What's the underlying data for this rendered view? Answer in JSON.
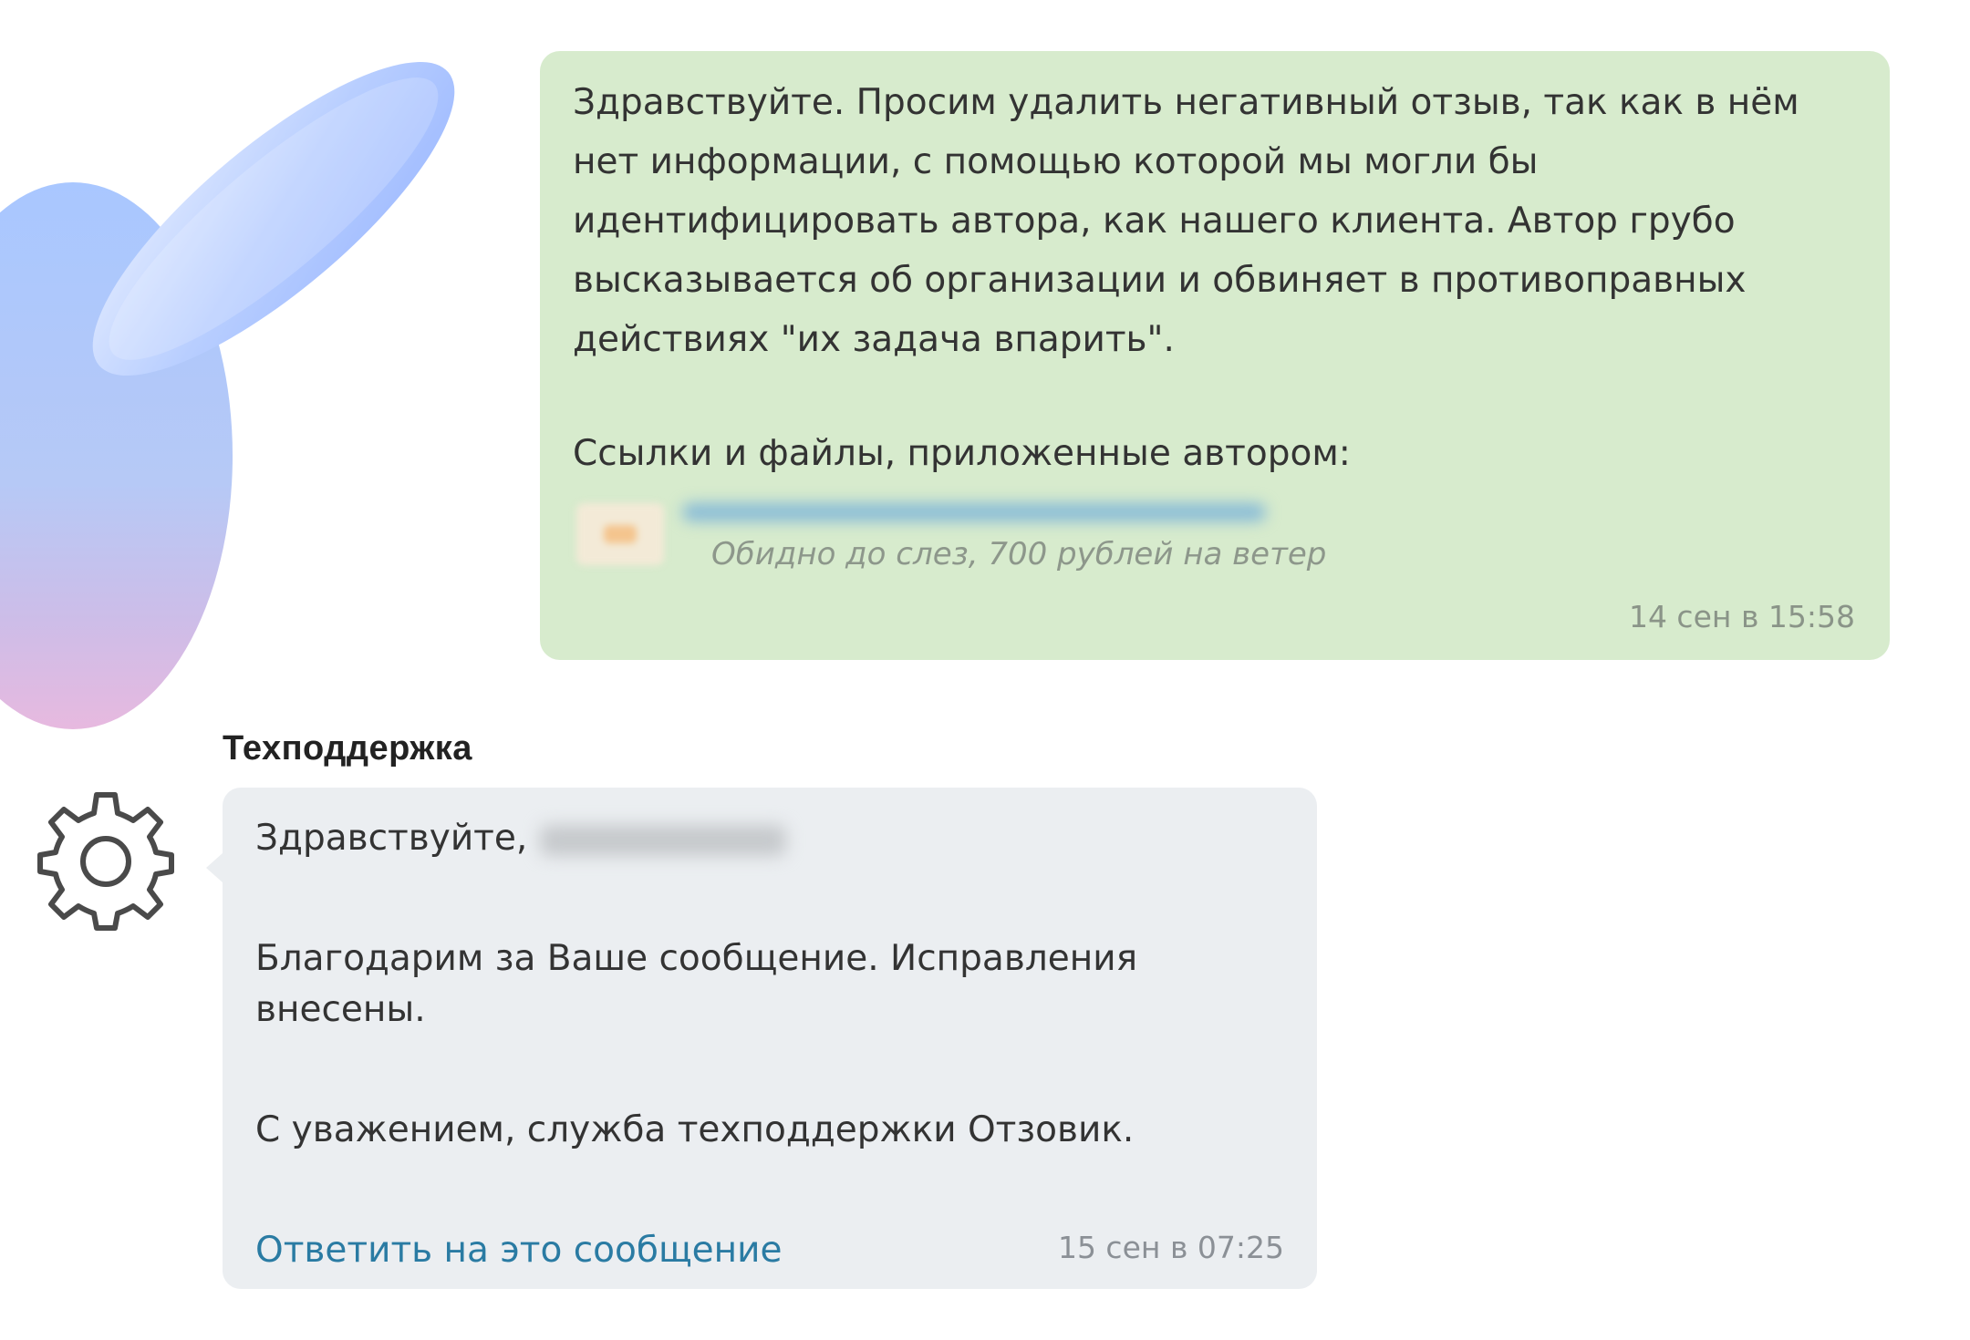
{
  "outgoing_message": {
    "text": "Здравствуйте. Просим удалить негативный отзыв, так как в нём нет информации, с помощью которой мы могли бы идентифицировать автора, как нашего клиента. Автор грубо высказывается об организации и обвиняет в противоправных действиях \"их задача впарить\".",
    "links_heading": "Ссылки и файлы, приложенные автором:",
    "attachment": {
      "subtitle": "Обидно до слез, 700 рублей на ветер"
    },
    "timestamp": "14 сен в 15:58",
    "background_color": "#d7ebcd"
  },
  "incoming_message": {
    "sender": "Техподдержка",
    "greeting": "Здравствуйте,",
    "body": "Благодарим за Ваше сообщение. Исправления внесены.",
    "signature": "С уважением, служба техподдержки Отзовик.",
    "reply_link": "Ответить на это сообщение",
    "timestamp": "15 сен в 07:25",
    "background_color": "#ebeef1",
    "link_color": "#2a7ba3"
  },
  "icons": {
    "sender_avatar": "gear-icon",
    "user_avatar": "bunny-avatar"
  }
}
